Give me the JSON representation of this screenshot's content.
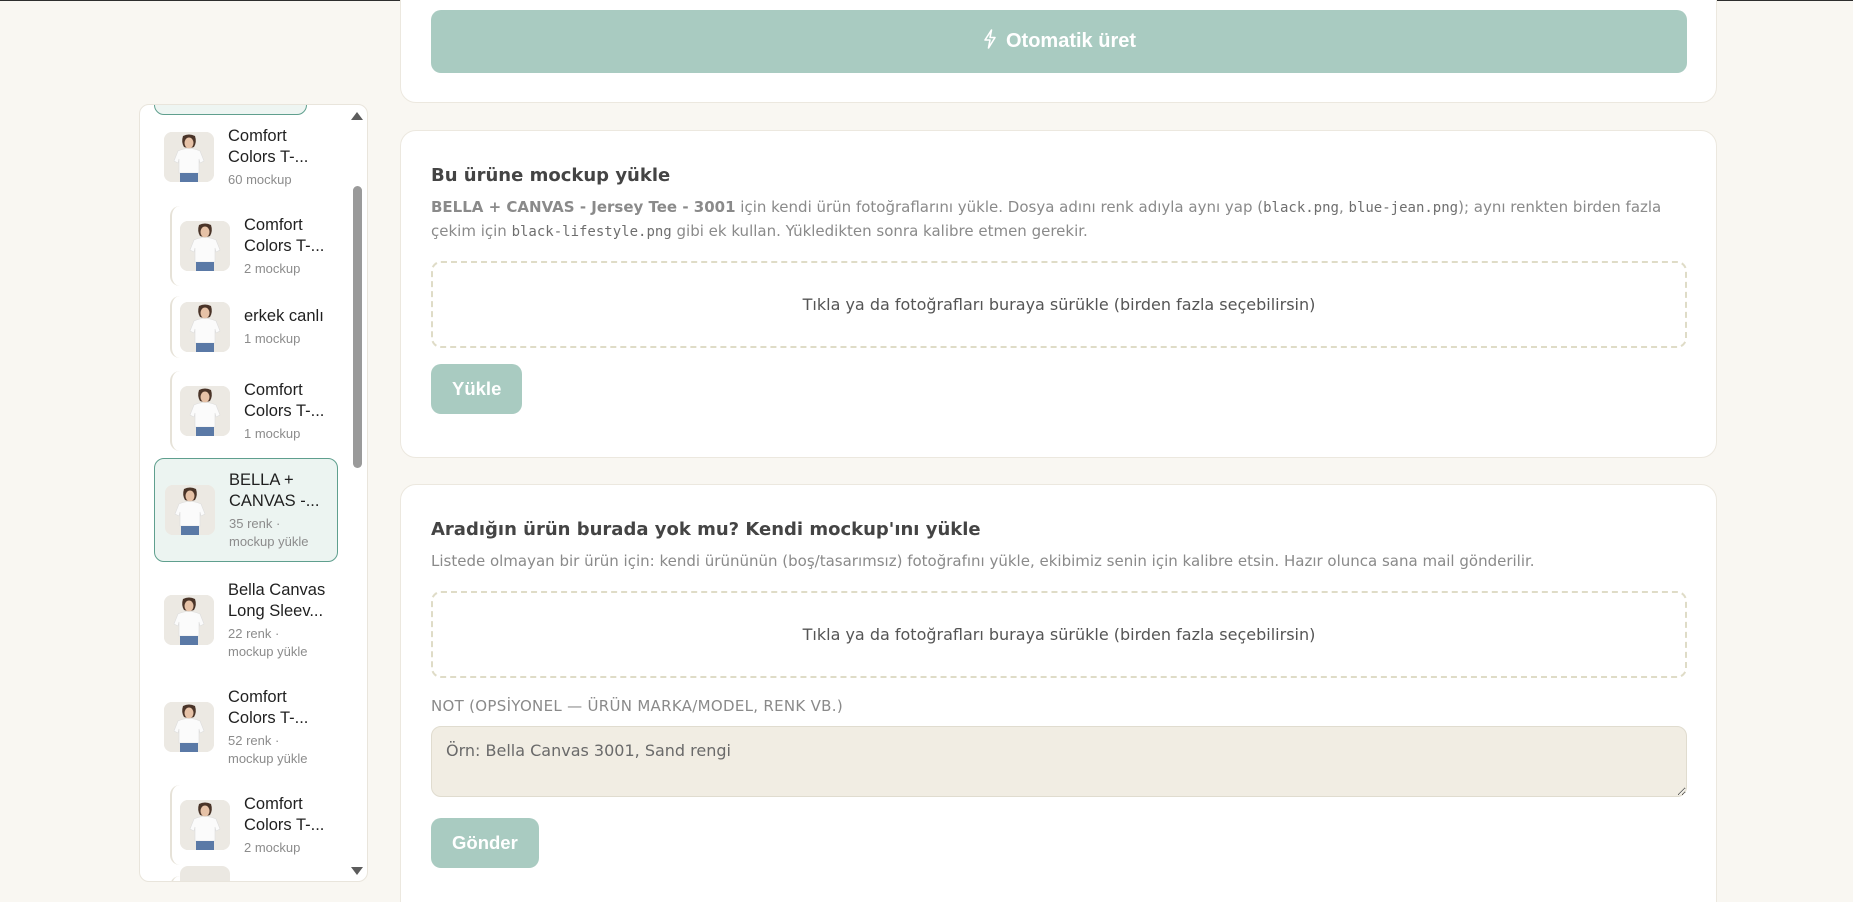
{
  "top_card": {
    "auto_generate_label": "Otomatik üret"
  },
  "sidebar": {
    "items": [
      {
        "name": "Comfort Colors T-...",
        "meta": "60 mockup",
        "child": false,
        "active": false
      },
      {
        "name": "Comfort Colors T-...",
        "meta": "2 mockup",
        "child": true,
        "active": false
      },
      {
        "name": "erkek canlı",
        "meta": "1 mockup",
        "child": true,
        "active": false
      },
      {
        "name": "Comfort Colors T-...",
        "meta": "1 mockup",
        "child": true,
        "active": false
      },
      {
        "name": "BELLA + CANVAS -...",
        "meta": "35 renk · mockup yükle",
        "child": false,
        "active": true
      },
      {
        "name": "Bella Canvas Long Sleev...",
        "meta": "22 renk · mockup yükle",
        "child": false,
        "active": false
      },
      {
        "name": "Comfort Colors T-...",
        "meta": "52 renk · mockup yükle",
        "child": false,
        "active": false
      },
      {
        "name": "Comfort Colors T-...",
        "meta": "2 mockup",
        "child": true,
        "active": false
      }
    ]
  },
  "upload_card": {
    "title": "Bu ürüne mockup yükle",
    "desc_product": "BELLA + CANVAS - Jersey Tee - 3001",
    "desc_part1": " için kendi ürün fotoğraflarını yükle. Dosya adını renk adıyla aynı yap (",
    "code1": "black.png",
    "desc_sep": ", ",
    "code2": "blue-jean.png",
    "desc_part2": "); aynı renkten birden fazla çekim için ",
    "code3": "black-lifestyle.png",
    "desc_part3": " gibi ek kullan. Yükledikten sonra kalibre etmen gerekir.",
    "dropzone_text": "Tıkla ya da fotoğrafları buraya sürükle (birden fazla seçebilirsin)",
    "upload_button": "Yükle"
  },
  "custom_card": {
    "title": "Aradığın ürün burada yok mu? Kendi mockup'ını yükle",
    "desc": "Listede olmayan bir ürün için: kendi ürününün (boş/tasarımsız) fotoğrafını yükle, ekibimiz senin için kalibre etsin. Hazır olunca sana mail gönderilir.",
    "dropzone_text": "Tıkla ya da fotoğrafları buraya sürükle (birden fazla seçebilirsin)",
    "note_label": "NOT (OPSİYONEL — ÜRÜN MARKA/MODEL, RENK VB.)",
    "note_placeholder": "Örn: Bella Canvas 3001, Sand rengi",
    "note_value": "",
    "submit_button": "Gönder"
  },
  "colors": {
    "accent": "#a9cbc1",
    "active_border": "#5f9f8e",
    "background": "#f9f7f2"
  }
}
